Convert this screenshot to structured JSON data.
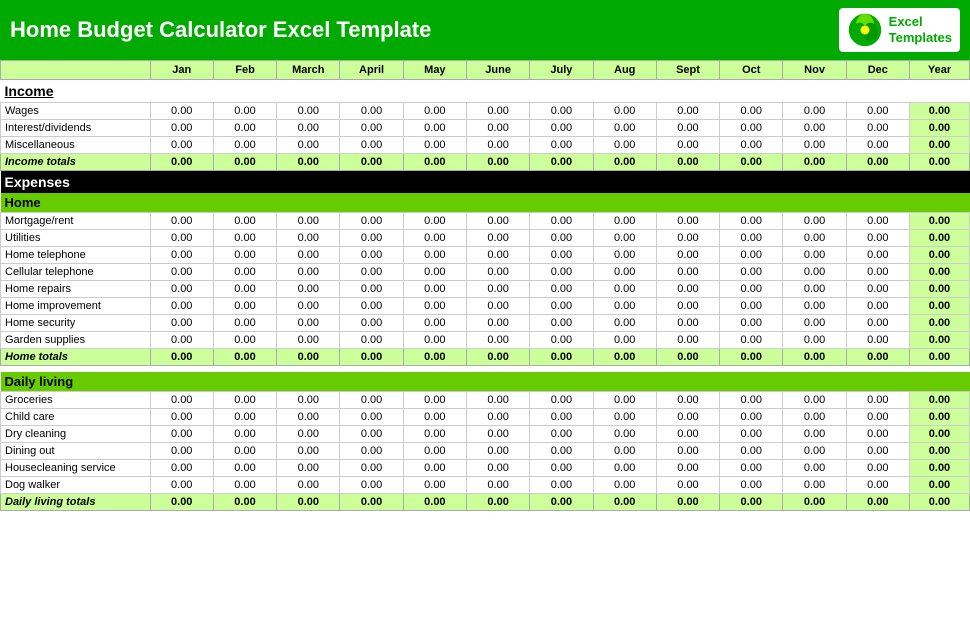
{
  "header": {
    "title": "Home Budget Calculator Excel Template",
    "logo_line1": "Excel",
    "logo_line2": "Templates"
  },
  "columns": {
    "label": "",
    "months": [
      "Jan",
      "Feb",
      "March",
      "April",
      "May",
      "June",
      "July",
      "Aug",
      "Sept",
      "Oct",
      "Nov",
      "Dec",
      "Year"
    ]
  },
  "income": {
    "section_label": "Income",
    "rows": [
      {
        "label": "Wages",
        "values": [
          "0.00",
          "0.00",
          "0.00",
          "0.00",
          "0.00",
          "0.00",
          "0.00",
          "0.00",
          "0.00",
          "0.00",
          "0.00",
          "0.00",
          "0.00"
        ]
      },
      {
        "label": "Interest/dividends",
        "values": [
          "0.00",
          "0.00",
          "0.00",
          "0.00",
          "0.00",
          "0.00",
          "0.00",
          "0.00",
          "0.00",
          "0.00",
          "0.00",
          "0.00",
          "0.00"
        ]
      },
      {
        "label": "Miscellaneous",
        "values": [
          "0.00",
          "0.00",
          "0.00",
          "0.00",
          "0.00",
          "0.00",
          "0.00",
          "0.00",
          "0.00",
          "0.00",
          "0.00",
          "0.00",
          "0.00"
        ]
      }
    ],
    "total_label": "Income totals",
    "total_values": [
      "0.00",
      "0.00",
      "0.00",
      "0.00",
      "0.00",
      "0.00",
      "0.00",
      "0.00",
      "0.00",
      "0.00",
      "0.00",
      "0.00",
      "0.00"
    ]
  },
  "expenses": {
    "section_label": "Expenses",
    "home": {
      "subsection_label": "Home",
      "rows": [
        {
          "label": "Mortgage/rent",
          "values": [
            "0.00",
            "0.00",
            "0.00",
            "0.00",
            "0.00",
            "0.00",
            "0.00",
            "0.00",
            "0.00",
            "0.00",
            "0.00",
            "0.00",
            "0.00"
          ]
        },
        {
          "label": "Utilities",
          "values": [
            "0.00",
            "0.00",
            "0.00",
            "0.00",
            "0.00",
            "0.00",
            "0.00",
            "0.00",
            "0.00",
            "0.00",
            "0.00",
            "0.00",
            "0.00"
          ]
        },
        {
          "label": "Home telephone",
          "values": [
            "0.00",
            "0.00",
            "0.00",
            "0.00",
            "0.00",
            "0.00",
            "0.00",
            "0.00",
            "0.00",
            "0.00",
            "0.00",
            "0.00",
            "0.00"
          ]
        },
        {
          "label": "Cellular telephone",
          "values": [
            "0.00",
            "0.00",
            "0.00",
            "0.00",
            "0.00",
            "0.00",
            "0.00",
            "0.00",
            "0.00",
            "0.00",
            "0.00",
            "0.00",
            "0.00"
          ]
        },
        {
          "label": "Home repairs",
          "values": [
            "0.00",
            "0.00",
            "0.00",
            "0.00",
            "0.00",
            "0.00",
            "0.00",
            "0.00",
            "0.00",
            "0.00",
            "0.00",
            "0.00",
            "0.00"
          ]
        },
        {
          "label": "Home improvement",
          "values": [
            "0.00",
            "0.00",
            "0.00",
            "0.00",
            "0.00",
            "0.00",
            "0.00",
            "0.00",
            "0.00",
            "0.00",
            "0.00",
            "0.00",
            "0.00"
          ]
        },
        {
          "label": "Home security",
          "values": [
            "0.00",
            "0.00",
            "0.00",
            "0.00",
            "0.00",
            "0.00",
            "0.00",
            "0.00",
            "0.00",
            "0.00",
            "0.00",
            "0.00",
            "0.00"
          ]
        },
        {
          "label": "Garden supplies",
          "values": [
            "0.00",
            "0.00",
            "0.00",
            "0.00",
            "0.00",
            "0.00",
            "0.00",
            "0.00",
            "0.00",
            "0.00",
            "0.00",
            "0.00",
            "0.00"
          ]
        }
      ],
      "total_label": "Home totals",
      "total_values": [
        "0.00",
        "0.00",
        "0.00",
        "0.00",
        "0.00",
        "0.00",
        "0.00",
        "0.00",
        "0.00",
        "0.00",
        "0.00",
        "0.00",
        "0.00"
      ]
    },
    "daily_living": {
      "subsection_label": "Daily living",
      "rows": [
        {
          "label": "Groceries",
          "values": [
            "0.00",
            "0.00",
            "0.00",
            "0.00",
            "0.00",
            "0.00",
            "0.00",
            "0.00",
            "0.00",
            "0.00",
            "0.00",
            "0.00",
            "0.00"
          ]
        },
        {
          "label": "Child care",
          "values": [
            "0.00",
            "0.00",
            "0.00",
            "0.00",
            "0.00",
            "0.00",
            "0.00",
            "0.00",
            "0.00",
            "0.00",
            "0.00",
            "0.00",
            "0.00"
          ]
        },
        {
          "label": "Dry cleaning",
          "values": [
            "0.00",
            "0.00",
            "0.00",
            "0.00",
            "0.00",
            "0.00",
            "0.00",
            "0.00",
            "0.00",
            "0.00",
            "0.00",
            "0.00",
            "0.00"
          ]
        },
        {
          "label": "Dining out",
          "values": [
            "0.00",
            "0.00",
            "0.00",
            "0.00",
            "0.00",
            "0.00",
            "0.00",
            "0.00",
            "0.00",
            "0.00",
            "0.00",
            "0.00",
            "0.00"
          ]
        },
        {
          "label": "Housecleaning service",
          "values": [
            "0.00",
            "0.00",
            "0.00",
            "0.00",
            "0.00",
            "0.00",
            "0.00",
            "0.00",
            "0.00",
            "0.00",
            "0.00",
            "0.00",
            "0.00"
          ]
        },
        {
          "label": "Dog walker",
          "values": [
            "0.00",
            "0.00",
            "0.00",
            "0.00",
            "0.00",
            "0.00",
            "0.00",
            "0.00",
            "0.00",
            "0.00",
            "0.00",
            "0.00",
            "0.00"
          ]
        }
      ],
      "total_label": "Daily living totals",
      "total_values": [
        "0.00",
        "0.00",
        "0.00",
        "0.00",
        "0.00",
        "0.00",
        "0.00",
        "0.00",
        "0.00",
        "0.00",
        "0.00",
        "0.00",
        "0.00"
      ]
    }
  }
}
